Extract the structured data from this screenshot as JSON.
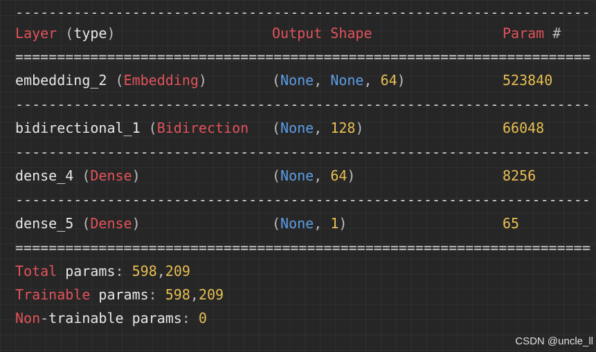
{
  "separators": {
    "dash": "----------------------------------------------------------------------",
    "equal": "======================================================================"
  },
  "header": {
    "layer_word": "Layer",
    "type_open": " (",
    "type_word": "type",
    "type_close": ")",
    "output_shape": "Output Shape",
    "param_word": "Param",
    "param_hash": " #"
  },
  "rows": [
    {
      "name": "embedding_2",
      "type": "Embedding",
      "shape": [
        {
          "t": "(",
          "c": "grey"
        },
        {
          "t": "None",
          "c": "blue"
        },
        {
          "t": ", ",
          "c": "grey"
        },
        {
          "t": "None",
          "c": "blue"
        },
        {
          "t": ", ",
          "c": "grey"
        },
        {
          "t": "64",
          "c": "yellow"
        },
        {
          "t": ")",
          "c": "grey"
        }
      ],
      "params": "523840"
    },
    {
      "name": "bidirectional_1",
      "type": "Bidirection",
      "shape": [
        {
          "t": "(",
          "c": "grey"
        },
        {
          "t": "None",
          "c": "blue"
        },
        {
          "t": ", ",
          "c": "grey"
        },
        {
          "t": "128",
          "c": "yellow"
        },
        {
          "t": ")",
          "c": "grey"
        }
      ],
      "params": "66048",
      "truncated": true
    },
    {
      "name": "dense_4",
      "type": "Dense",
      "shape": [
        {
          "t": "(",
          "c": "grey"
        },
        {
          "t": "None",
          "c": "blue"
        },
        {
          "t": ", ",
          "c": "grey"
        },
        {
          "t": "64",
          "c": "yellow"
        },
        {
          "t": ")",
          "c": "grey"
        }
      ],
      "params": "8256"
    },
    {
      "name": "dense_5",
      "type": "Dense",
      "shape": [
        {
          "t": "(",
          "c": "grey"
        },
        {
          "t": "None",
          "c": "blue"
        },
        {
          "t": ", ",
          "c": "grey"
        },
        {
          "t": "1",
          "c": "yellow"
        },
        {
          "t": ")",
          "c": "grey"
        }
      ],
      "params": "65"
    }
  ],
  "totals": {
    "total_word": "Total",
    "total_rest": " params",
    "total_colon": ": ",
    "total_a": "598",
    "total_comma": ",",
    "total_b": "209",
    "trainable_word": "Trainable",
    "trainable_rest": " params",
    "trainable_colon": ": ",
    "trainable_a": "598",
    "trainable_comma": ",",
    "trainable_b": "209",
    "non_word": "Non",
    "non_dash": "-",
    "non_rest": "trainable params",
    "non_colon": ": ",
    "non_value": "0"
  },
  "watermark": "CSDN @uncle_ll",
  "colors": {
    "background": "#262626",
    "red": "#e2535b",
    "blue": "#5b9ee6",
    "yellow": "#e8bf52",
    "text": "#e8e8e8"
  }
}
